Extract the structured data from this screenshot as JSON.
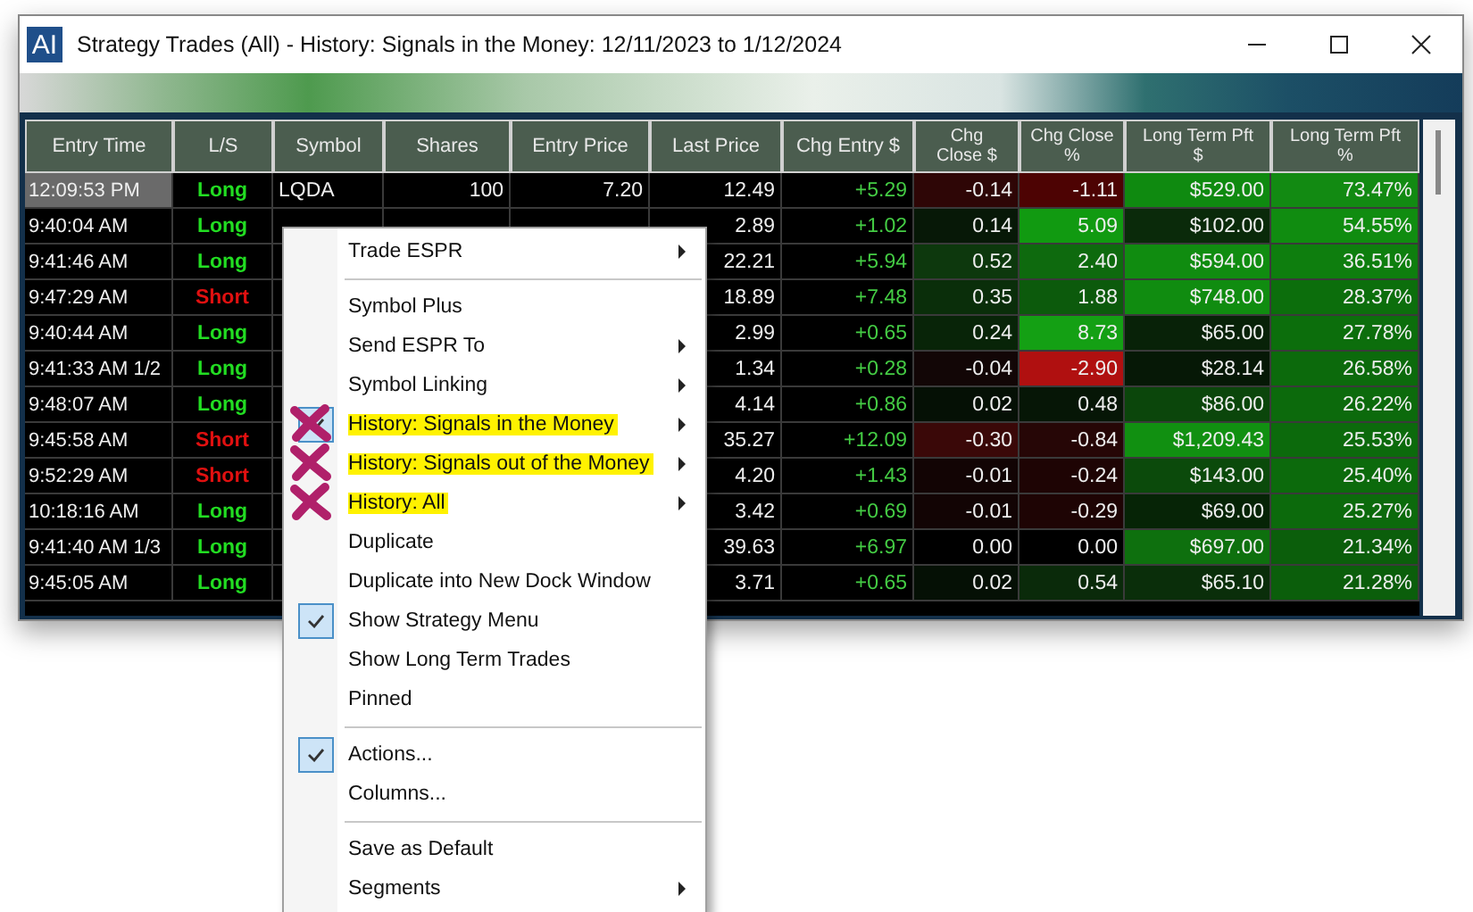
{
  "window": {
    "logo_text": "AI",
    "title": "Strategy Trades (All) - History: Signals in the Money: 12/11/2023 to 1/12/2024"
  },
  "table": {
    "columns": [
      "Entry Time",
      "L/S",
      "Symbol",
      "Shares",
      "Entry Price",
      "Last Price",
      "Chg Entry $",
      "Chg\nClose $",
      "Chg Close\n%",
      "Long Term Pft\n$",
      "Long Term Pft\n%"
    ],
    "rows": [
      {
        "selected": true,
        "time": "12:09:53 PM",
        "side": {
          "text": "Long",
          "kind": "long"
        },
        "symbol": "LQDA",
        "shares": "100",
        "entry_price": "7.20",
        "last_price": "12.49",
        "chg_entry": "+5.29",
        "chg_close": {
          "text": "-0.14",
          "color": "#2e0606"
        },
        "chg_close_pct": {
          "text": "-1.11",
          "color": "#4d0303"
        },
        "lt_pft": {
          "text": "$529.00",
          "color": "#0f8a10"
        },
        "lt_pft_pct": {
          "text": "73.47%",
          "color": "#128a12"
        }
      },
      {
        "selected": false,
        "time": "9:40:04 AM",
        "side": {
          "text": "Long",
          "kind": "long"
        },
        "last_price": "2.89",
        "chg_entry": "+1.02",
        "chg_close": {
          "text": "0.14",
          "color": "#071807"
        },
        "chg_close_pct": {
          "text": "5.09",
          "color": "#119a11"
        },
        "lt_pft": {
          "text": "$102.00",
          "color": "#0a2a0a"
        },
        "lt_pft_pct": {
          "text": "54.55%",
          "color": "#108c10"
        }
      },
      {
        "selected": false,
        "time": "9:41:46 AM",
        "side": {
          "text": "Long",
          "kind": "long"
        },
        "last_price": "22.21",
        "chg_entry": "+5.94",
        "chg_close": {
          "text": "0.52",
          "color": "#0d380d"
        },
        "chg_close_pct": {
          "text": "2.40",
          "color": "#0e6a0e"
        },
        "lt_pft": {
          "text": "$594.00",
          "color": "#108c10"
        },
        "lt_pft_pct": {
          "text": "36.51%",
          "color": "#0e7e0e"
        }
      },
      {
        "selected": false,
        "time": "9:47:29 AM",
        "side": {
          "text": "Short",
          "kind": "short"
        },
        "last_price": "18.89",
        "chg_entry": "+7.48",
        "chg_close": {
          "text": "0.35",
          "color": "#0a2e0a"
        },
        "chg_close_pct": {
          "text": "1.88",
          "color": "#0c5a0c"
        },
        "lt_pft": {
          "text": "$748.00",
          "color": "#108c10"
        },
        "lt_pft_pct": {
          "text": "28.37%",
          "color": "#0c6e0c"
        }
      },
      {
        "selected": false,
        "time": "9:40:44 AM",
        "side": {
          "text": "Long",
          "kind": "long"
        },
        "last_price": "2.99",
        "chg_entry": "+0.65",
        "chg_close": {
          "text": "0.24",
          "color": "#082408"
        },
        "chg_close_pct": {
          "text": "8.73",
          "color": "#14a014"
        },
        "lt_pft": {
          "text": "$65.00",
          "color": "#082208"
        },
        "lt_pft_pct": {
          "text": "27.78%",
          "color": "#0c6e0c"
        }
      },
      {
        "selected": false,
        "time": "9:41:33 AM 1/2",
        "side": {
          "text": "Long",
          "kind": "long"
        },
        "last_price": "1.34",
        "chg_entry": "+0.28",
        "chg_close": {
          "text": "-0.04",
          "color": "#120606"
        },
        "chg_close_pct": {
          "text": "-2.90",
          "color": "#b01010"
        },
        "lt_pft": {
          "text": "$28.14",
          "color": "#061806"
        },
        "lt_pft_pct": {
          "text": "26.58%",
          "color": "#0c6a0c"
        }
      },
      {
        "selected": false,
        "time": "9:48:07 AM",
        "side": {
          "text": "Long",
          "kind": "long"
        },
        "last_price": "4.14",
        "chg_entry": "+0.86",
        "chg_close": {
          "text": "0.02",
          "color": "#051005"
        },
        "chg_close_pct": {
          "text": "0.48",
          "color": "#061606"
        },
        "lt_pft": {
          "text": "$86.00",
          "color": "#0b460b"
        },
        "lt_pft_pct": {
          "text": "26.22%",
          "color": "#0c6a0c"
        }
      },
      {
        "selected": false,
        "time": "9:45:58 AM",
        "side": {
          "text": "Short",
          "kind": "short"
        },
        "last_price": "35.27",
        "chg_entry": "+12.09",
        "chg_close": {
          "text": "-0.30",
          "color": "#3a0808"
        },
        "chg_close_pct": {
          "text": "-0.84",
          "color": "#260606"
        },
        "lt_pft": {
          "text": "$1,209.43",
          "color": "#119011"
        },
        "lt_pft_pct": {
          "text": "25.53%",
          "color": "#0c6a0c"
        }
      },
      {
        "selected": false,
        "time": "9:52:29 AM",
        "side": {
          "text": "Short",
          "kind": "short"
        },
        "last_price": "4.20",
        "chg_entry": "+1.43",
        "chg_close": {
          "text": "-0.01",
          "color": "#120404"
        },
        "chg_close_pct": {
          "text": "-0.24",
          "color": "#1e0404"
        },
        "lt_pft": {
          "text": "$143.00",
          "color": "#0b4a0b"
        },
        "lt_pft_pct": {
          "text": "25.40%",
          "color": "#0c6a0c"
        }
      },
      {
        "selected": false,
        "time": "10:18:16 AM",
        "side": {
          "text": "Long",
          "kind": "long"
        },
        "last_price": "3.42",
        "chg_entry": "+0.69",
        "chg_close": {
          "text": "-0.01",
          "color": "#120404"
        },
        "chg_close_pct": {
          "text": "-0.29",
          "color": "#1e0404"
        },
        "lt_pft": {
          "text": "$69.00",
          "color": "#062406"
        },
        "lt_pft_pct": {
          "text": "25.27%",
          "color": "#0c6a0c"
        }
      },
      {
        "selected": false,
        "time": "9:41:40 AM 1/3",
        "side": {
          "text": "Long",
          "kind": "long"
        },
        "last_price": "39.63",
        "chg_entry": "+6.97",
        "chg_close": {
          "text": "0.00",
          "color": "#000000"
        },
        "chg_close_pct": {
          "text": "0.00",
          "color": "#000000"
        },
        "lt_pft": {
          "text": "$697.00",
          "color": "#0e700e"
        },
        "lt_pft_pct": {
          "text": "21.34%",
          "color": "#0b5e0b"
        }
      },
      {
        "selected": false,
        "time": "9:45:05 AM",
        "side": {
          "text": "Long",
          "kind": "long"
        },
        "last_price": "3.71",
        "chg_entry": "+0.65",
        "chg_close": {
          "text": "0.02",
          "color": "#051005"
        },
        "chg_close_pct": {
          "text": "0.54",
          "color": "#0a2a0a"
        },
        "lt_pft": {
          "text": "$65.10",
          "color": "#0a2e0a"
        },
        "lt_pft_pct": {
          "text": "21.28%",
          "color": "#0b5e0b"
        }
      }
    ]
  },
  "context_menu": {
    "items": [
      {
        "kind": "item",
        "label": "Trade ESPR",
        "checked": false,
        "submenu": true,
        "highlighted": false,
        "crossed_out": false
      },
      {
        "kind": "separator"
      },
      {
        "kind": "item",
        "label": "Symbol Plus",
        "checked": false,
        "submenu": false,
        "highlighted": false,
        "crossed_out": false
      },
      {
        "kind": "item",
        "label": "Send ESPR To",
        "checked": false,
        "submenu": true,
        "highlighted": false,
        "crossed_out": false
      },
      {
        "kind": "item",
        "label": "Symbol Linking",
        "checked": false,
        "submenu": true,
        "highlighted": false,
        "crossed_out": false
      },
      {
        "kind": "item",
        "label": "History: Signals in the Money",
        "checked": true,
        "submenu": true,
        "highlighted": true,
        "crossed_out": true
      },
      {
        "kind": "item",
        "label": "History: Signals out of the Money",
        "checked": false,
        "submenu": true,
        "highlighted": true,
        "crossed_out": true
      },
      {
        "kind": "item",
        "label": "History: All",
        "checked": false,
        "submenu": true,
        "highlighted": true,
        "crossed_out": true
      },
      {
        "kind": "item",
        "label": "Duplicate",
        "checked": false,
        "submenu": false,
        "highlighted": false,
        "crossed_out": false
      },
      {
        "kind": "item",
        "label": "Duplicate into New Dock Window",
        "checked": false,
        "submenu": false,
        "highlighted": false,
        "crossed_out": false
      },
      {
        "kind": "item",
        "label": "Show Strategy Menu",
        "checked": true,
        "submenu": false,
        "highlighted": false,
        "crossed_out": false
      },
      {
        "kind": "item",
        "label": "Show Long Term Trades",
        "checked": false,
        "submenu": false,
        "highlighted": false,
        "crossed_out": false
      },
      {
        "kind": "item",
        "label": "Pinned",
        "checked": false,
        "submenu": false,
        "highlighted": false,
        "crossed_out": false
      },
      {
        "kind": "separator"
      },
      {
        "kind": "item",
        "label": "Actions...",
        "checked": true,
        "submenu": false,
        "highlighted": false,
        "crossed_out": false
      },
      {
        "kind": "item",
        "label": "Columns...",
        "checked": false,
        "submenu": false,
        "highlighted": false,
        "crossed_out": false
      },
      {
        "kind": "separator"
      },
      {
        "kind": "item",
        "label": "Save as Default",
        "checked": false,
        "submenu": false,
        "highlighted": false,
        "crossed_out": false
      },
      {
        "kind": "item",
        "label": "Segments",
        "checked": false,
        "submenu": true,
        "highlighted": false,
        "crossed_out": false
      }
    ]
  }
}
